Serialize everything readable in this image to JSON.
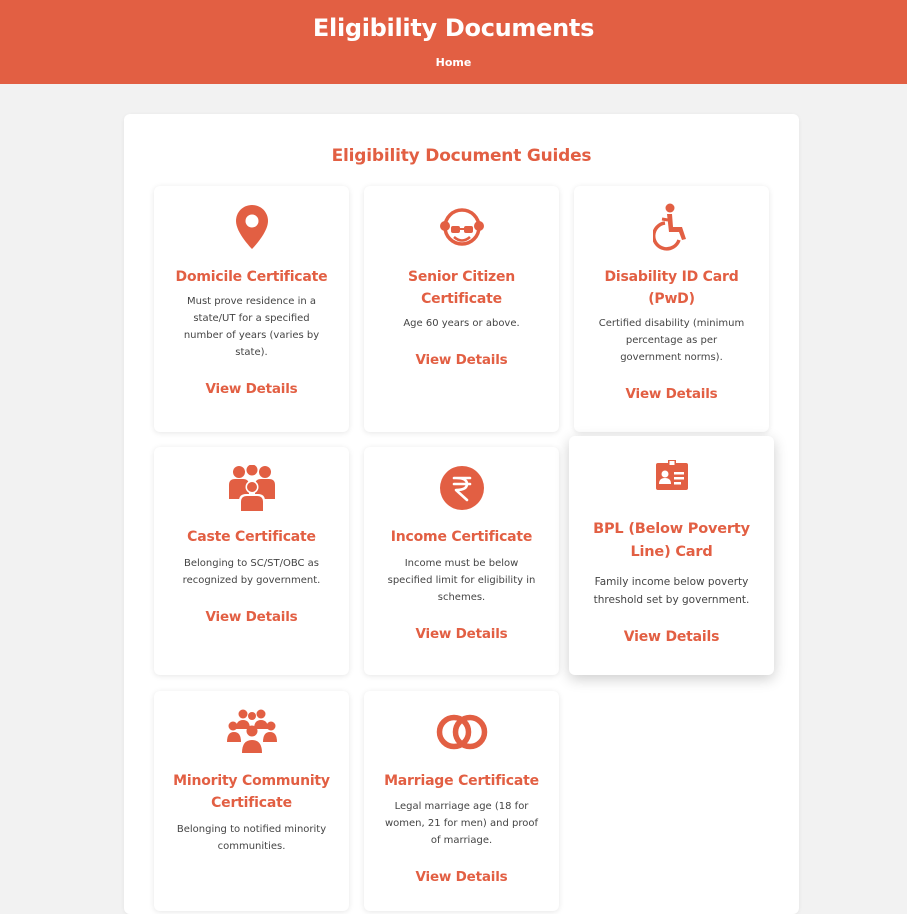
{
  "header": {
    "title": "Eligibility Documents",
    "nav_home": "Home"
  },
  "section": {
    "title": "Eligibility Document Guides"
  },
  "accent_color": "#e25f43",
  "cards": [
    {
      "icon": "map-pin-icon",
      "title": "Domicile Certificate",
      "description": "Must prove residence in a state/UT for a specified number of years (varies by state).",
      "link": "View Details"
    },
    {
      "icon": "elderly-person-icon",
      "title": "Senior Citizen Certificate",
      "description": "Age 60 years or above.",
      "link": "View Details"
    },
    {
      "icon": "wheelchair-icon",
      "title": "Disability ID Card (PwD)",
      "description": "Certified disability (minimum percentage as per government norms).",
      "link": "View Details"
    },
    {
      "icon": "people-group-icon",
      "title": "Caste Certificate",
      "description": "Belonging to SC/ST/OBC as recognized by government.",
      "link": "View Details"
    },
    {
      "icon": "rupee-icon",
      "title": "Income Certificate",
      "description": "Income must be below specified limit for eligibility in schemes.",
      "link": "View Details"
    },
    {
      "icon": "id-card-icon",
      "title": "BPL (Below Poverty Line) Card",
      "description": "Family income below poverty threshold set by government.",
      "link": "View Details"
    },
    {
      "icon": "community-icon",
      "title": "Minority Community Certificate",
      "description": "Belonging to notified minority communities.",
      "link": "View Details"
    },
    {
      "icon": "rings-icon",
      "title": "Marriage Certificate",
      "description": "Legal marriage age (18 for women, 21 for men) and proof of marriage.",
      "link": "View Details"
    }
  ]
}
